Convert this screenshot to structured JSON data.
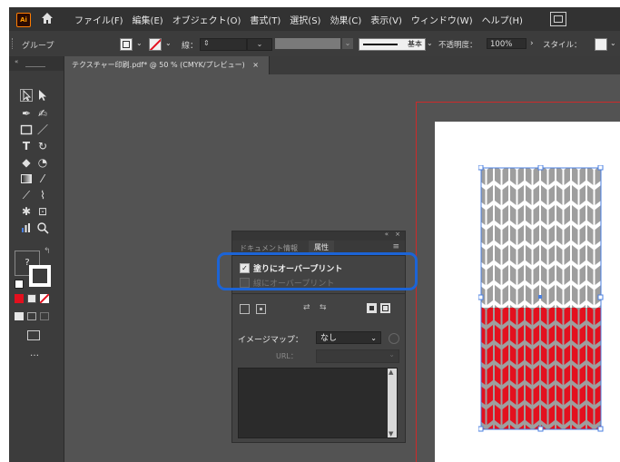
{
  "app": {
    "logo_text": "Ai"
  },
  "menu": [
    "ファイル(F)",
    "編集(E)",
    "オブジェクト(O)",
    "書式(T)",
    "選択(S)",
    "効果(C)",
    "表示(V)",
    "ウィンドウ(W)",
    "ヘルプ(H)"
  ],
  "control": {
    "selection_label": "グループ",
    "stroke_label": "線：",
    "stroke_value": "",
    "brush_label": "基本",
    "opacity_label": "不透明度：",
    "opacity_value": "100%",
    "style_label": "スタイル："
  },
  "document_tab": {
    "title": "テクスチャー印刷.pdf* @ 50 % (CMYK/プレビュー)",
    "close": "×"
  },
  "tools_panel": {
    "more": "…",
    "swap": "?"
  },
  "attributes_panel": {
    "tabs": [
      "ドキュメント情報",
      "属性"
    ],
    "overprint_fill": "塗りにオーバープリント",
    "overprint_stroke": "線にオーバープリント",
    "image_map_label": "イメージマップ：",
    "image_map_value": "なし",
    "url_label": "URL："
  },
  "colors": {
    "app_bg": "#535353",
    "panel_bg": "#3c3c3c",
    "menu_bg": "#323232",
    "highlight_blue": "#1c64d6",
    "pattern_red": "#e3101e",
    "pattern_gray": "#9e9e9e",
    "selection_blue": "#4a7fe0"
  }
}
